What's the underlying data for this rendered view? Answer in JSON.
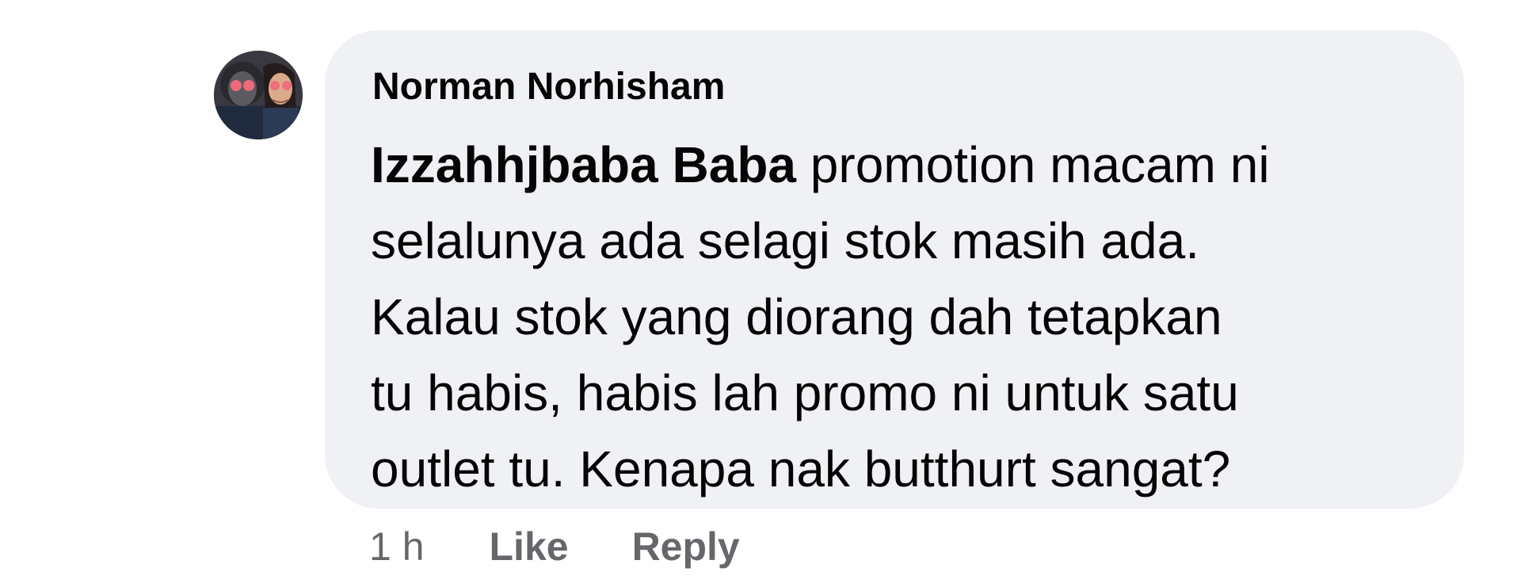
{
  "comment": {
    "author": "Norman Norhisham",
    "mention": "Izzahhjbaba Baba",
    "lines": {
      "first_rest": " promotion macam ni",
      "l2": "selalunya ada selagi stok masih ada.",
      "l3": "Kalau stok yang diorang dah tetapkan",
      "l4": "tu habis, habis lah promo ni untuk satu",
      "l5": "outlet tu. Kenapa nak butthurt sangat?"
    },
    "timestamp": "1 h",
    "like_label": "Like",
    "reply_label": "Reply"
  },
  "colors": {
    "bubble": "#f0f1f5",
    "text": "#050505",
    "meta": "#65676b"
  },
  "avatar": {
    "icon": "profile-photo"
  }
}
